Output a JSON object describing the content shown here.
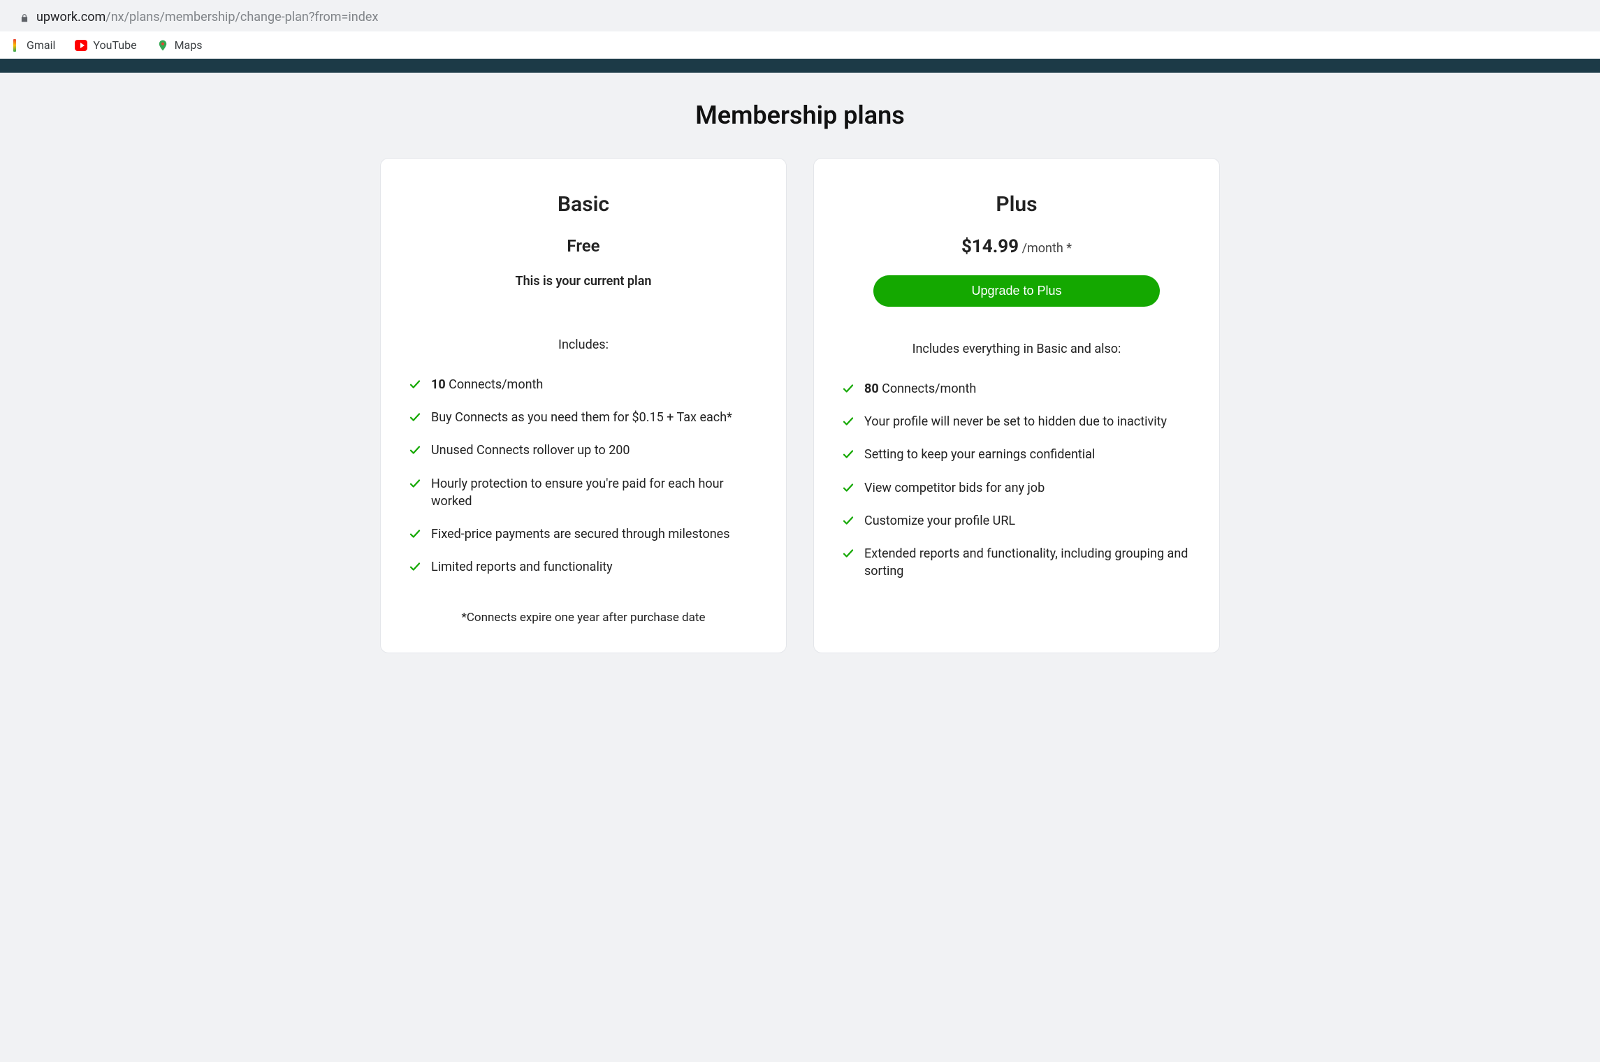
{
  "browser": {
    "url_domain": "upwork.com",
    "url_path": "/nx/plans/membership/change-plan?from=index",
    "bookmarks": [
      {
        "label": "Gmail",
        "icon": "gmail"
      },
      {
        "label": "YouTube",
        "icon": "youtube"
      },
      {
        "label": "Maps",
        "icon": "maps"
      }
    ]
  },
  "page": {
    "title": "Membership plans"
  },
  "plans": {
    "basic": {
      "name": "Basic",
      "price_label": "Free",
      "current_plan_text": "This is your current plan",
      "includes_label": "Includes:",
      "features": [
        {
          "bold": "10",
          "text": " Connects/month"
        },
        {
          "bold": "",
          "text": "Buy Connects as you need them for $0.15 + Tax each*"
        },
        {
          "bold": "",
          "text": "Unused Connects rollover up to 200"
        },
        {
          "bold": "",
          "text": "Hourly protection to ensure you're paid for each hour worked"
        },
        {
          "bold": "",
          "text": "Fixed-price payments are secured through milestones"
        },
        {
          "bold": "",
          "text": "Limited reports and functionality"
        }
      ],
      "footnote": "*Connects expire one year after purchase date"
    },
    "plus": {
      "name": "Plus",
      "price": "$14.99",
      "price_suffix": " /month *",
      "upgrade_button": "Upgrade to Plus",
      "includes_label": "Includes everything in Basic and also:",
      "features": [
        {
          "bold": "80",
          "text": " Connects/month"
        },
        {
          "bold": "",
          "text": "Your profile will never be set to hidden due to inactivity"
        },
        {
          "bold": "",
          "text": "Setting to keep your earnings confidential"
        },
        {
          "bold": "",
          "text": "View competitor bids for any job"
        },
        {
          "bold": "",
          "text": "Customize your profile URL"
        },
        {
          "bold": "",
          "text": "Extended reports and functionality, including grouping and sorting"
        }
      ]
    }
  }
}
